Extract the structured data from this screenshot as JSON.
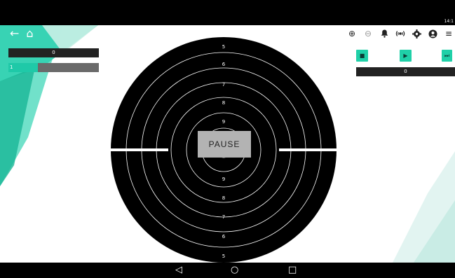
{
  "status": {
    "clock": "14:1"
  },
  "nav": {
    "back": "◁",
    "home": "○",
    "recent": "□"
  },
  "left": {
    "back_glyph": "←",
    "home_glyph": "⌂",
    "score": "0",
    "shot_index": "1"
  },
  "toolbar": {
    "zoom_in": "⊕",
    "zoom_out": "⊖",
    "bell": "🔔",
    "broadcast": "((•))",
    "settings": "⚙",
    "profile": "●",
    "menu": "≡"
  },
  "controls": {
    "stop": "■",
    "play": "▶",
    "next": "⏭",
    "total": "0"
  },
  "target": {
    "ring_labels_top": [
      "5",
      "6",
      "7",
      "8",
      "9"
    ],
    "ring_labels_bottom": [
      "9",
      "8",
      "7",
      "6",
      "5"
    ],
    "pause_label": "PAUSE"
  },
  "colors": {
    "accent": "#1fd0a8",
    "target": "#000000",
    "ring_line": "#ffffff"
  }
}
